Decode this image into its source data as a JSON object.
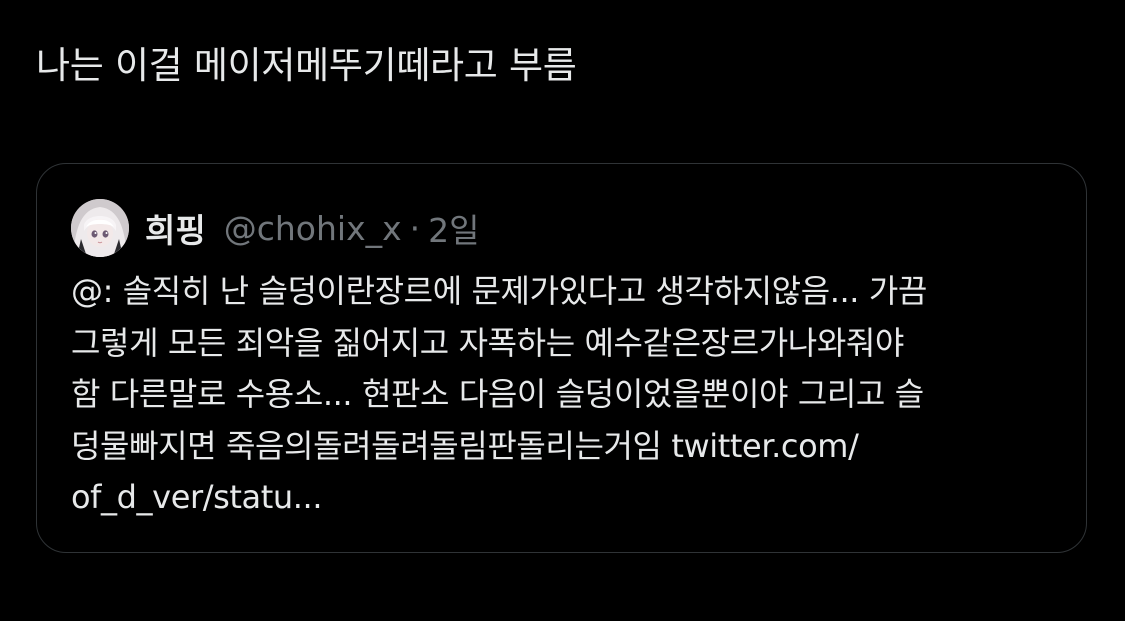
{
  "tweet": {
    "text": "나는 이걸 메이저메뚜기떼라고 부름"
  },
  "quote": {
    "author_name": "희핑",
    "author_handle": "@chohix_x",
    "separator": "·",
    "time": "2일",
    "lines": [
      "@: 솔직히 난 슬덩이란장르에 문제가있다고 생각하지않음... 가끔",
      "그렇게 모든 죄악을 짊어지고 자폭하는 예수같은장르가나와줘야",
      "함 다른말로 수용소... 현판소 다음이 슬덩이었을뿐이야 그리고 슬",
      "덩물빠지면 죽음의돌려돌려돌림판돌리는거임 twitter.com/",
      "of_d_ver/statu..."
    ]
  },
  "colors": {
    "background": "#000000",
    "primary_text": "#e7e9ea",
    "secondary_text": "#71767b",
    "card_border": "#2f3336"
  }
}
